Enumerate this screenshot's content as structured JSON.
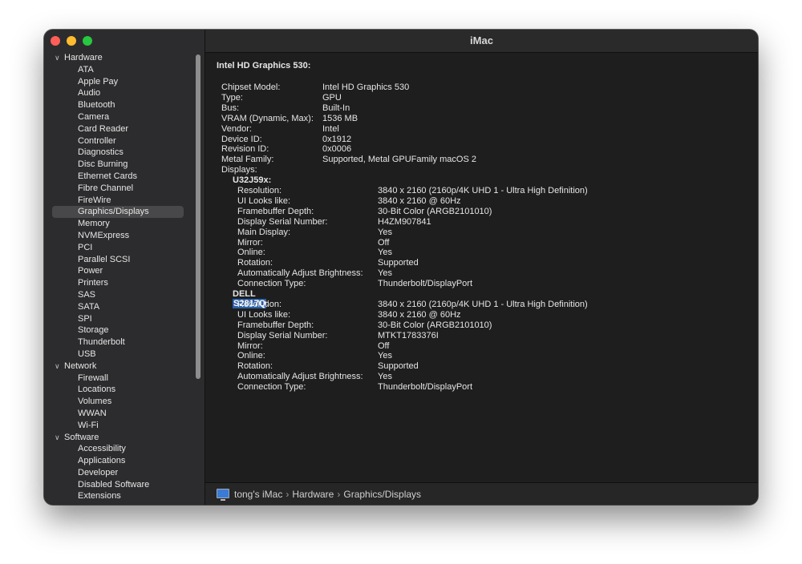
{
  "window": {
    "title": "iMac"
  },
  "sidebar": {
    "groups": [
      {
        "label": "Hardware",
        "items": [
          "ATA",
          "Apple Pay",
          "Audio",
          "Bluetooth",
          "Camera",
          "Card Reader",
          "Controller",
          "Diagnostics",
          "Disc Burning",
          "Ethernet Cards",
          "Fibre Channel",
          "FireWire",
          "Graphics/Displays",
          "Memory",
          "NVMExpress",
          "PCI",
          "Parallel SCSI",
          "Power",
          "Printers",
          "SAS",
          "SATA",
          "SPI",
          "Storage",
          "Thunderbolt",
          "USB"
        ]
      },
      {
        "label": "Network",
        "items": [
          "Firewall",
          "Locations",
          "Volumes",
          "WWAN",
          "Wi-Fi"
        ]
      },
      {
        "label": "Software",
        "items": [
          "Accessibility",
          "Applications",
          "Developer",
          "Disabled Software",
          "Extensions"
        ]
      }
    ],
    "selected": "Graphics/Displays"
  },
  "detail": {
    "heading": "Intel HD Graphics 530:",
    "properties": [
      {
        "k": "Chipset Model:",
        "v": "Intel HD Graphics 530"
      },
      {
        "k": "Type:",
        "v": "GPU"
      },
      {
        "k": "Bus:",
        "v": "Built-In"
      },
      {
        "k": "VRAM (Dynamic, Max):",
        "v": "1536 MB"
      },
      {
        "k": "Vendor:",
        "v": "Intel"
      },
      {
        "k": "Device ID:",
        "v": "0x1912"
      },
      {
        "k": "Revision ID:",
        "v": "0x0006"
      },
      {
        "k": "Metal Family:",
        "v": "Supported, Metal GPUFamily macOS 2"
      },
      {
        "k": "Displays:",
        "v": ""
      }
    ],
    "displays": [
      {
        "name_prefix": "U32J59x:",
        "name_highlight": "",
        "name_suffix": "",
        "props": [
          {
            "k": "Resolution:",
            "v": "3840 x 2160 (2160p/4K UHD 1 - Ultra High Definition)"
          },
          {
            "k": "UI Looks like:",
            "v": "3840 x 2160 @ 60Hz"
          },
          {
            "k": "Framebuffer Depth:",
            "v": "30-Bit Color (ARGB2101010)"
          },
          {
            "k": "Display Serial Number:",
            "v": "H4ZM907841"
          },
          {
            "k": "Main Display:",
            "v": "Yes"
          },
          {
            "k": "Mirror:",
            "v": "Off"
          },
          {
            "k": "Online:",
            "v": "Yes"
          },
          {
            "k": "Rotation:",
            "v": "Supported"
          },
          {
            "k": "Automatically Adjust Brightness:",
            "v": "Yes"
          },
          {
            "k": "Connection Type:",
            "v": "Thunderbolt/DisplayPort"
          }
        ]
      },
      {
        "name_prefix": "DELL ",
        "name_highlight": "S2817Q",
        "name_suffix": ":",
        "props": [
          {
            "k": "Resolution:",
            "v": "3840 x 2160 (2160p/4K UHD 1 - Ultra High Definition)"
          },
          {
            "k": "UI Looks like:",
            "v": "3840 x 2160 @ 60Hz"
          },
          {
            "k": "Framebuffer Depth:",
            "v": "30-Bit Color (ARGB2101010)"
          },
          {
            "k": "Display Serial Number:",
            "v": "MTKT1783376I"
          },
          {
            "k": "Mirror:",
            "v": "Off"
          },
          {
            "k": "Online:",
            "v": "Yes"
          },
          {
            "k": "Rotation:",
            "v": "Supported"
          },
          {
            "k": "Automatically Adjust Brightness:",
            "v": "Yes"
          },
          {
            "k": "Connection Type:",
            "v": "Thunderbolt/DisplayPort"
          }
        ]
      }
    ]
  },
  "pathbar": {
    "icon": "imac-icon",
    "crumbs": [
      "tong's iMac",
      "Hardware",
      "Graphics/Displays"
    ],
    "separator": "›"
  }
}
